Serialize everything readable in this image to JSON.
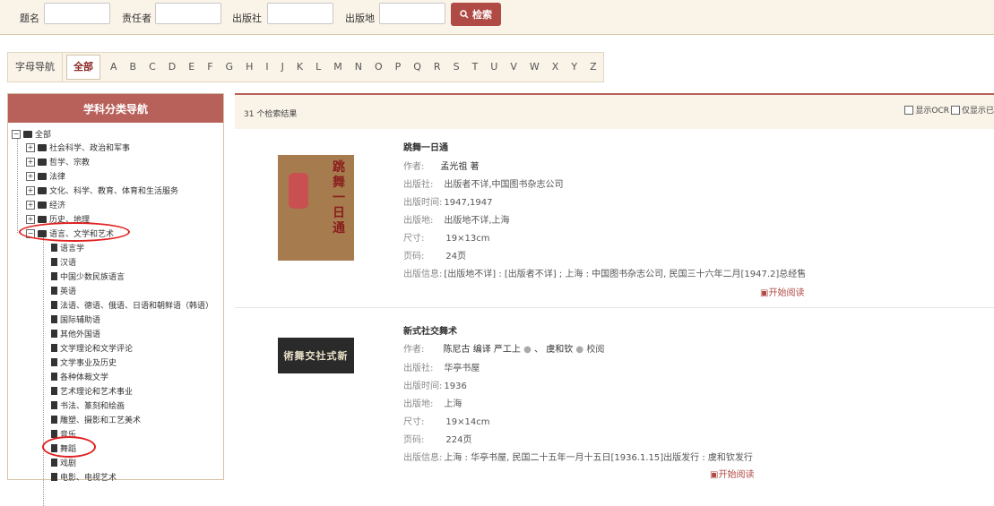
{
  "search": {
    "title_label": "题名",
    "author_label": "责任者",
    "publisher_label": "出版社",
    "place_label": "出版地",
    "button_label": "检索"
  },
  "alpha_nav": {
    "label": "字母导航",
    "all": "全部",
    "letters": [
      "A",
      "B",
      "C",
      "D",
      "E",
      "F",
      "G",
      "H",
      "I",
      "J",
      "K",
      "L",
      "M",
      "N",
      "O",
      "P",
      "Q",
      "R",
      "S",
      "T",
      "U",
      "V",
      "W",
      "X",
      "Y",
      "Z"
    ]
  },
  "sidebar": {
    "title": "学科分类导航",
    "root": "全部",
    "top_items": [
      "社会科学、政治和军事",
      "哲学、宗教",
      "法律",
      "文化、科学、教育、体育和生活服务",
      "经济",
      "历史、地理"
    ],
    "expanded": "语言、文学和艺术",
    "children": [
      "语言学",
      "汉语",
      "中国少数民族语言",
      "英语",
      "法语、德语、俄语、日语和朝鲜语（韩语）",
      "国际辅助语",
      "其他外国语",
      "文学理论和文学评论",
      "文学事业及历史",
      "各种体裁文学",
      "艺术理论和艺术事业",
      "书法、篆刻和绘画",
      "雕塑、摄影和工艺美术",
      "音乐",
      "舞蹈",
      "戏剧",
      "电影、电视艺术"
    ]
  },
  "results": {
    "count_text": "31 个检索结果",
    "ocr_label": "显示OCR",
    "only_label": "仅显示已"
  },
  "books": [
    {
      "title": "跳舞一日通",
      "author_label": "作者:",
      "author": "孟光祖 著",
      "publisher_label": "出版社:",
      "publisher": "出版者不详,中国图书杂志公司",
      "time_label": "出版时间:",
      "time": "1947,1947",
      "place_label": "出版地:",
      "place": "出版地不详,上海",
      "size_label": "尺寸:",
      "size": "19×13cm",
      "pages_label": "页码:",
      "pages": "24页",
      "info_label": "出版信息:",
      "info": "[出版地不详] : [出版者不详] ; 上海 : 中国图书杂志公司, 民国三十六年二月[1947.2]总经售",
      "read": "开始阅读",
      "cover_text": "跳舞一日通"
    },
    {
      "title": "新式社交舞术",
      "author_label": "作者:",
      "author": "陈尼古 编译  严工上",
      "author2": "、 虞和钦",
      "author3": "校阅",
      "publisher_label": "出版社:",
      "publisher": "华亭书屋",
      "time_label": "出版时间:",
      "time": "1936",
      "place_label": "出版地:",
      "place": "上海",
      "size_label": "尺寸:",
      "size": "19×14cm",
      "pages_label": "页码:",
      "pages": "224页",
      "info_label": "出版信息:",
      "info": "上海 : 华亭书屋, 民国二十五年一月十五日[1936.1.15]出版发行 : 虞和钦发行",
      "read": "开始阅读",
      "cover_text": "術舞交社式新"
    }
  ],
  "colors": {
    "accent": "#b8605a",
    "button": "#b04a44",
    "highlight": "#e02020"
  }
}
